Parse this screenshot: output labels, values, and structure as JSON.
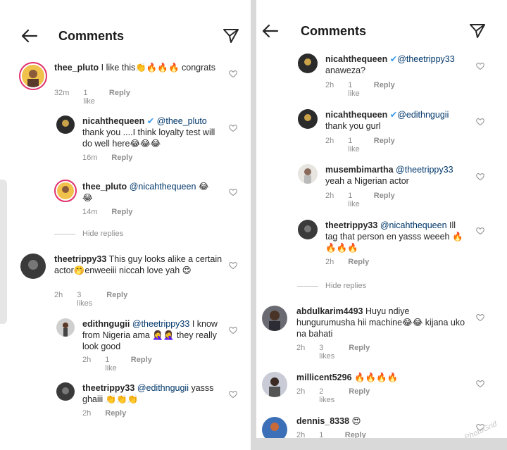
{
  "left": {
    "header": {
      "title": "Comments"
    },
    "comments": [
      {
        "user": "thee_pluto",
        "mention": "",
        "text": " I like this👏🔥🔥🔥 congrats",
        "time": "32m",
        "likes": "1 like",
        "reply": "Reply"
      },
      {
        "user": "nicahthequeen",
        "mention": "@thee_pluto",
        "text": "thank you ....I think loyalty test will do well here😂😂😂",
        "time": "16m",
        "likes": "",
        "reply": "Reply"
      },
      {
        "user": "thee_pluto",
        "mention": "@nicahthequeen",
        "text": " 😂😂",
        "time": "14m",
        "likes": "",
        "reply": "Reply"
      },
      {
        "user": "theetrippy33",
        "mention": "",
        "text": " This guy looks alike a certain actor🤭enweeiii niccah love yah 😍",
        "time": "2h",
        "likes": "3 likes",
        "reply": "Reply"
      },
      {
        "user": "edithngugii",
        "mention": "@theetrippy33",
        "text": " I know from Nigeria ama 🤦‍♀️🤦‍♀️ they really look good",
        "time": "2h",
        "likes": "1 like",
        "reply": "Reply"
      },
      {
        "user": "theetrippy33",
        "mention": "@edithngugii",
        "text": " yasss ghaiii 👏👏👏",
        "time": "2h",
        "likes": "",
        "reply": "Reply"
      }
    ],
    "hide_replies": "Hide replies"
  },
  "right": {
    "header": {
      "title": "Comments"
    },
    "comments": [
      {
        "user": "nicahthequeen",
        "mention": "@theetrippy33",
        "text": "anaweza?",
        "time": "2h",
        "likes": "1 like",
        "reply": "Reply"
      },
      {
        "user": "nicahthequeen",
        "mention": "@edithngugii",
        "text": "thank you gurl",
        "time": "2h",
        "likes": "1 like",
        "reply": "Reply"
      },
      {
        "user": "musembimartha",
        "mention": "@theetrippy33",
        "text": "yeah a Nigerian actor",
        "time": "2h",
        "likes": "1 like",
        "reply": "Reply"
      },
      {
        "user": "theetrippy33",
        "mention": "@nicahthequeen",
        "text": " Ill tag that person en yasss weeeh 🔥🔥🔥🔥",
        "time": "2h",
        "likes": "",
        "reply": "Reply"
      },
      {
        "user": "abdulkarim4493",
        "mention": "",
        "text": " Huyu ndiye hungurumusha hii machine😂😂 kijana uko na bahati",
        "time": "2h",
        "likes": "3 likes",
        "reply": "Reply"
      },
      {
        "user": "millicent5296",
        "mention": "",
        "text": " 🔥🔥🔥🔥",
        "time": "2h",
        "likes": "2 likes",
        "reply": "Reply"
      },
      {
        "user": "dennis_8338",
        "mention": "",
        "text": " 😍",
        "time": "2h",
        "likes": "1 like",
        "reply": "Reply"
      }
    ],
    "hide_replies": "Hide replies"
  },
  "watermark": "PhotoGrid",
  "colors": {
    "mention": "#00376b",
    "meta": "#8e8e8e",
    "verified": "#3897f0",
    "story_ring": "#e1306c"
  }
}
